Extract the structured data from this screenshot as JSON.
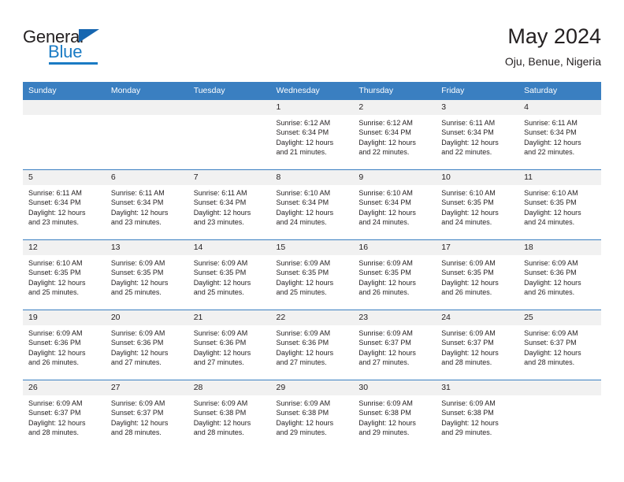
{
  "brand": {
    "name_top": "General",
    "name_bottom": "Blue",
    "triangle_icon": "triangle-icon",
    "color_dark": "#231f20",
    "color_blue": "#1a7bc4"
  },
  "header": {
    "title": "May 2024",
    "subtitle": "Oju, Benue, Nigeria"
  },
  "theme": {
    "header_blue": "#3a7fc1",
    "daynum_bg": "#f1f1f1",
    "text": "#231f20"
  },
  "weekday_headers": [
    "Sunday",
    "Monday",
    "Tuesday",
    "Wednesday",
    "Thursday",
    "Friday",
    "Saturday"
  ],
  "weeks": [
    [
      {
        "day": "",
        "lines": [
          "",
          "",
          "",
          ""
        ]
      },
      {
        "day": "",
        "lines": [
          "",
          "",
          "",
          ""
        ]
      },
      {
        "day": "",
        "lines": [
          "",
          "",
          "",
          ""
        ]
      },
      {
        "day": "1",
        "lines": [
          "Sunrise: 6:12 AM",
          "Sunset: 6:34 PM",
          "Daylight: 12 hours",
          "and 21 minutes."
        ]
      },
      {
        "day": "2",
        "lines": [
          "Sunrise: 6:12 AM",
          "Sunset: 6:34 PM",
          "Daylight: 12 hours",
          "and 22 minutes."
        ]
      },
      {
        "day": "3",
        "lines": [
          "Sunrise: 6:11 AM",
          "Sunset: 6:34 PM",
          "Daylight: 12 hours",
          "and 22 minutes."
        ]
      },
      {
        "day": "4",
        "lines": [
          "Sunrise: 6:11 AM",
          "Sunset: 6:34 PM",
          "Daylight: 12 hours",
          "and 22 minutes."
        ]
      }
    ],
    [
      {
        "day": "5",
        "lines": [
          "Sunrise: 6:11 AM",
          "Sunset: 6:34 PM",
          "Daylight: 12 hours",
          "and 23 minutes."
        ]
      },
      {
        "day": "6",
        "lines": [
          "Sunrise: 6:11 AM",
          "Sunset: 6:34 PM",
          "Daylight: 12 hours",
          "and 23 minutes."
        ]
      },
      {
        "day": "7",
        "lines": [
          "Sunrise: 6:11 AM",
          "Sunset: 6:34 PM",
          "Daylight: 12 hours",
          "and 23 minutes."
        ]
      },
      {
        "day": "8",
        "lines": [
          "Sunrise: 6:10 AM",
          "Sunset: 6:34 PM",
          "Daylight: 12 hours",
          "and 24 minutes."
        ]
      },
      {
        "day": "9",
        "lines": [
          "Sunrise: 6:10 AM",
          "Sunset: 6:34 PM",
          "Daylight: 12 hours",
          "and 24 minutes."
        ]
      },
      {
        "day": "10",
        "lines": [
          "Sunrise: 6:10 AM",
          "Sunset: 6:35 PM",
          "Daylight: 12 hours",
          "and 24 minutes."
        ]
      },
      {
        "day": "11",
        "lines": [
          "Sunrise: 6:10 AM",
          "Sunset: 6:35 PM",
          "Daylight: 12 hours",
          "and 24 minutes."
        ]
      }
    ],
    [
      {
        "day": "12",
        "lines": [
          "Sunrise: 6:10 AM",
          "Sunset: 6:35 PM",
          "Daylight: 12 hours",
          "and 25 minutes."
        ]
      },
      {
        "day": "13",
        "lines": [
          "Sunrise: 6:09 AM",
          "Sunset: 6:35 PM",
          "Daylight: 12 hours",
          "and 25 minutes."
        ]
      },
      {
        "day": "14",
        "lines": [
          "Sunrise: 6:09 AM",
          "Sunset: 6:35 PM",
          "Daylight: 12 hours",
          "and 25 minutes."
        ]
      },
      {
        "day": "15",
        "lines": [
          "Sunrise: 6:09 AM",
          "Sunset: 6:35 PM",
          "Daylight: 12 hours",
          "and 25 minutes."
        ]
      },
      {
        "day": "16",
        "lines": [
          "Sunrise: 6:09 AM",
          "Sunset: 6:35 PM",
          "Daylight: 12 hours",
          "and 26 minutes."
        ]
      },
      {
        "day": "17",
        "lines": [
          "Sunrise: 6:09 AM",
          "Sunset: 6:35 PM",
          "Daylight: 12 hours",
          "and 26 minutes."
        ]
      },
      {
        "day": "18",
        "lines": [
          "Sunrise: 6:09 AM",
          "Sunset: 6:36 PM",
          "Daylight: 12 hours",
          "and 26 minutes."
        ]
      }
    ],
    [
      {
        "day": "19",
        "lines": [
          "Sunrise: 6:09 AM",
          "Sunset: 6:36 PM",
          "Daylight: 12 hours",
          "and 26 minutes."
        ]
      },
      {
        "day": "20",
        "lines": [
          "Sunrise: 6:09 AM",
          "Sunset: 6:36 PM",
          "Daylight: 12 hours",
          "and 27 minutes."
        ]
      },
      {
        "day": "21",
        "lines": [
          "Sunrise: 6:09 AM",
          "Sunset: 6:36 PM",
          "Daylight: 12 hours",
          "and 27 minutes."
        ]
      },
      {
        "day": "22",
        "lines": [
          "Sunrise: 6:09 AM",
          "Sunset: 6:36 PM",
          "Daylight: 12 hours",
          "and 27 minutes."
        ]
      },
      {
        "day": "23",
        "lines": [
          "Sunrise: 6:09 AM",
          "Sunset: 6:37 PM",
          "Daylight: 12 hours",
          "and 27 minutes."
        ]
      },
      {
        "day": "24",
        "lines": [
          "Sunrise: 6:09 AM",
          "Sunset: 6:37 PM",
          "Daylight: 12 hours",
          "and 28 minutes."
        ]
      },
      {
        "day": "25",
        "lines": [
          "Sunrise: 6:09 AM",
          "Sunset: 6:37 PM",
          "Daylight: 12 hours",
          "and 28 minutes."
        ]
      }
    ],
    [
      {
        "day": "26",
        "lines": [
          "Sunrise: 6:09 AM",
          "Sunset: 6:37 PM",
          "Daylight: 12 hours",
          "and 28 minutes."
        ]
      },
      {
        "day": "27",
        "lines": [
          "Sunrise: 6:09 AM",
          "Sunset: 6:37 PM",
          "Daylight: 12 hours",
          "and 28 minutes."
        ]
      },
      {
        "day": "28",
        "lines": [
          "Sunrise: 6:09 AM",
          "Sunset: 6:38 PM",
          "Daylight: 12 hours",
          "and 28 minutes."
        ]
      },
      {
        "day": "29",
        "lines": [
          "Sunrise: 6:09 AM",
          "Sunset: 6:38 PM",
          "Daylight: 12 hours",
          "and 29 minutes."
        ]
      },
      {
        "day": "30",
        "lines": [
          "Sunrise: 6:09 AM",
          "Sunset: 6:38 PM",
          "Daylight: 12 hours",
          "and 29 minutes."
        ]
      },
      {
        "day": "31",
        "lines": [
          "Sunrise: 6:09 AM",
          "Sunset: 6:38 PM",
          "Daylight: 12 hours",
          "and 29 minutes."
        ]
      },
      {
        "day": "",
        "lines": [
          "",
          "",
          "",
          ""
        ]
      }
    ]
  ]
}
